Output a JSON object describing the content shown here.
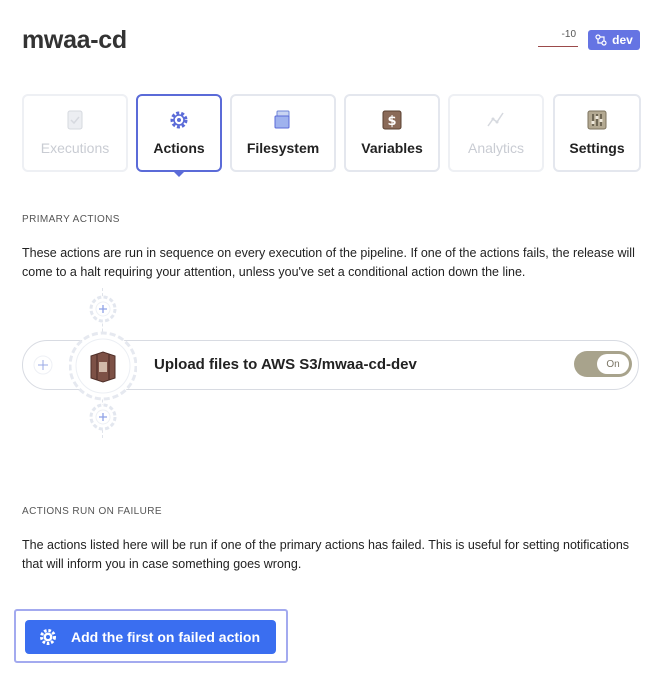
{
  "header": {
    "title": "mwaa-cd",
    "sparkline_value": "-10",
    "environment": "dev"
  },
  "tabs": [
    {
      "label": "Executions",
      "icon": "executions-icon",
      "state": "disabled"
    },
    {
      "label": "Actions",
      "icon": "gear-icon",
      "state": "active"
    },
    {
      "label": "Filesystem",
      "icon": "filesystem-icon",
      "state": "normal"
    },
    {
      "label": "Variables",
      "icon": "dollar-icon",
      "state": "normal"
    },
    {
      "label": "Analytics",
      "icon": "analytics-icon",
      "state": "disabled"
    },
    {
      "label": "Settings",
      "icon": "settings-icon",
      "state": "normal"
    }
  ],
  "primary_actions": {
    "heading": "PRIMARY ACTIONS",
    "description": "These actions are run in sequence on every execution of the pipeline. If one of the actions fails, the release will come to a halt requiring your attention, unless you've set a conditional action down the line.",
    "actions": [
      {
        "label": "Upload files to AWS S3/mwaa-cd-dev",
        "icon": "aws-s3-icon",
        "toggle_label": "On",
        "enabled": true
      }
    ]
  },
  "failure_actions": {
    "heading": "ACTIONS RUN ON FAILURE",
    "description": "The actions listed here will be run if one of the primary actions has failed. This is useful for setting notifications that will inform you in case something goes wrong.",
    "add_button_label": "Add the first on failed action"
  },
  "colors": {
    "accent": "#5b6bd8",
    "env_badge": "#6574e3",
    "primary_button": "#3a6ef0",
    "toggle_on": "#a8a38c"
  }
}
